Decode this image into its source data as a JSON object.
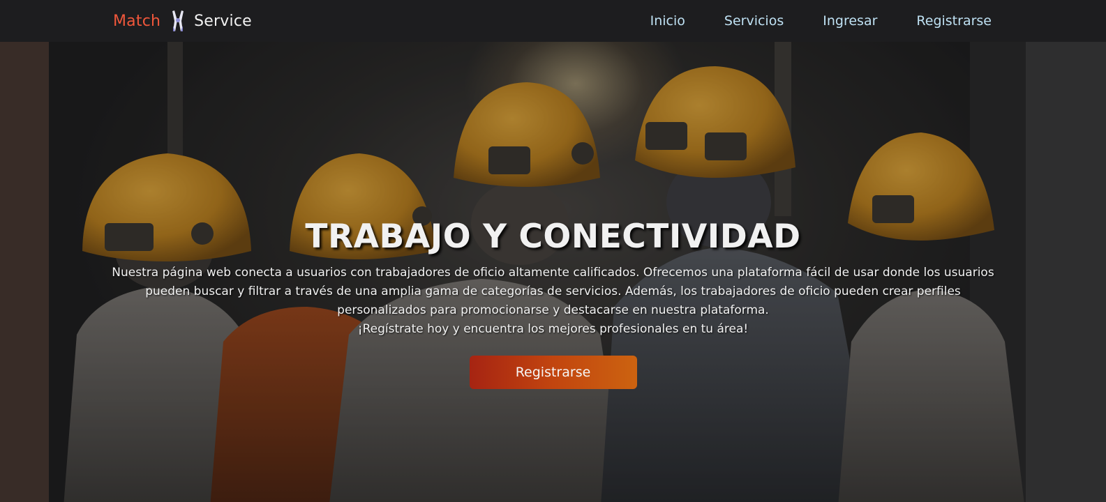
{
  "brand": {
    "part1": "Match",
    "part2": "Service",
    "icon": "pliers-icon",
    "accent_color": "#f0573b"
  },
  "nav": {
    "items": [
      {
        "label": "Inicio"
      },
      {
        "label": "Servicios"
      },
      {
        "label": "Ingresar"
      },
      {
        "label": "Registrarse"
      }
    ],
    "link_color": "#bfe1f3"
  },
  "hero": {
    "title": "TRABAJO Y CONECTIVIDAD",
    "paragraph": "Nuestra página web conecta a usuarios con trabajadores de oficio altamente calificados. Ofrecemos una plataforma fácil de usar donde los usuarios pueden buscar y filtrar a través de una amplia gama de categorías de servicios. Además, los trabajadores de oficio pueden crear perfiles personalizados para promocionarse y destacarse en nuestra plataforma.",
    "tagline": "¡Regístrate hoy y encuentra los mejores profesionales en tu área!",
    "cta_label": "Registrarse",
    "cta_gradient": [
      "#a62412",
      "#cc6310"
    ]
  }
}
